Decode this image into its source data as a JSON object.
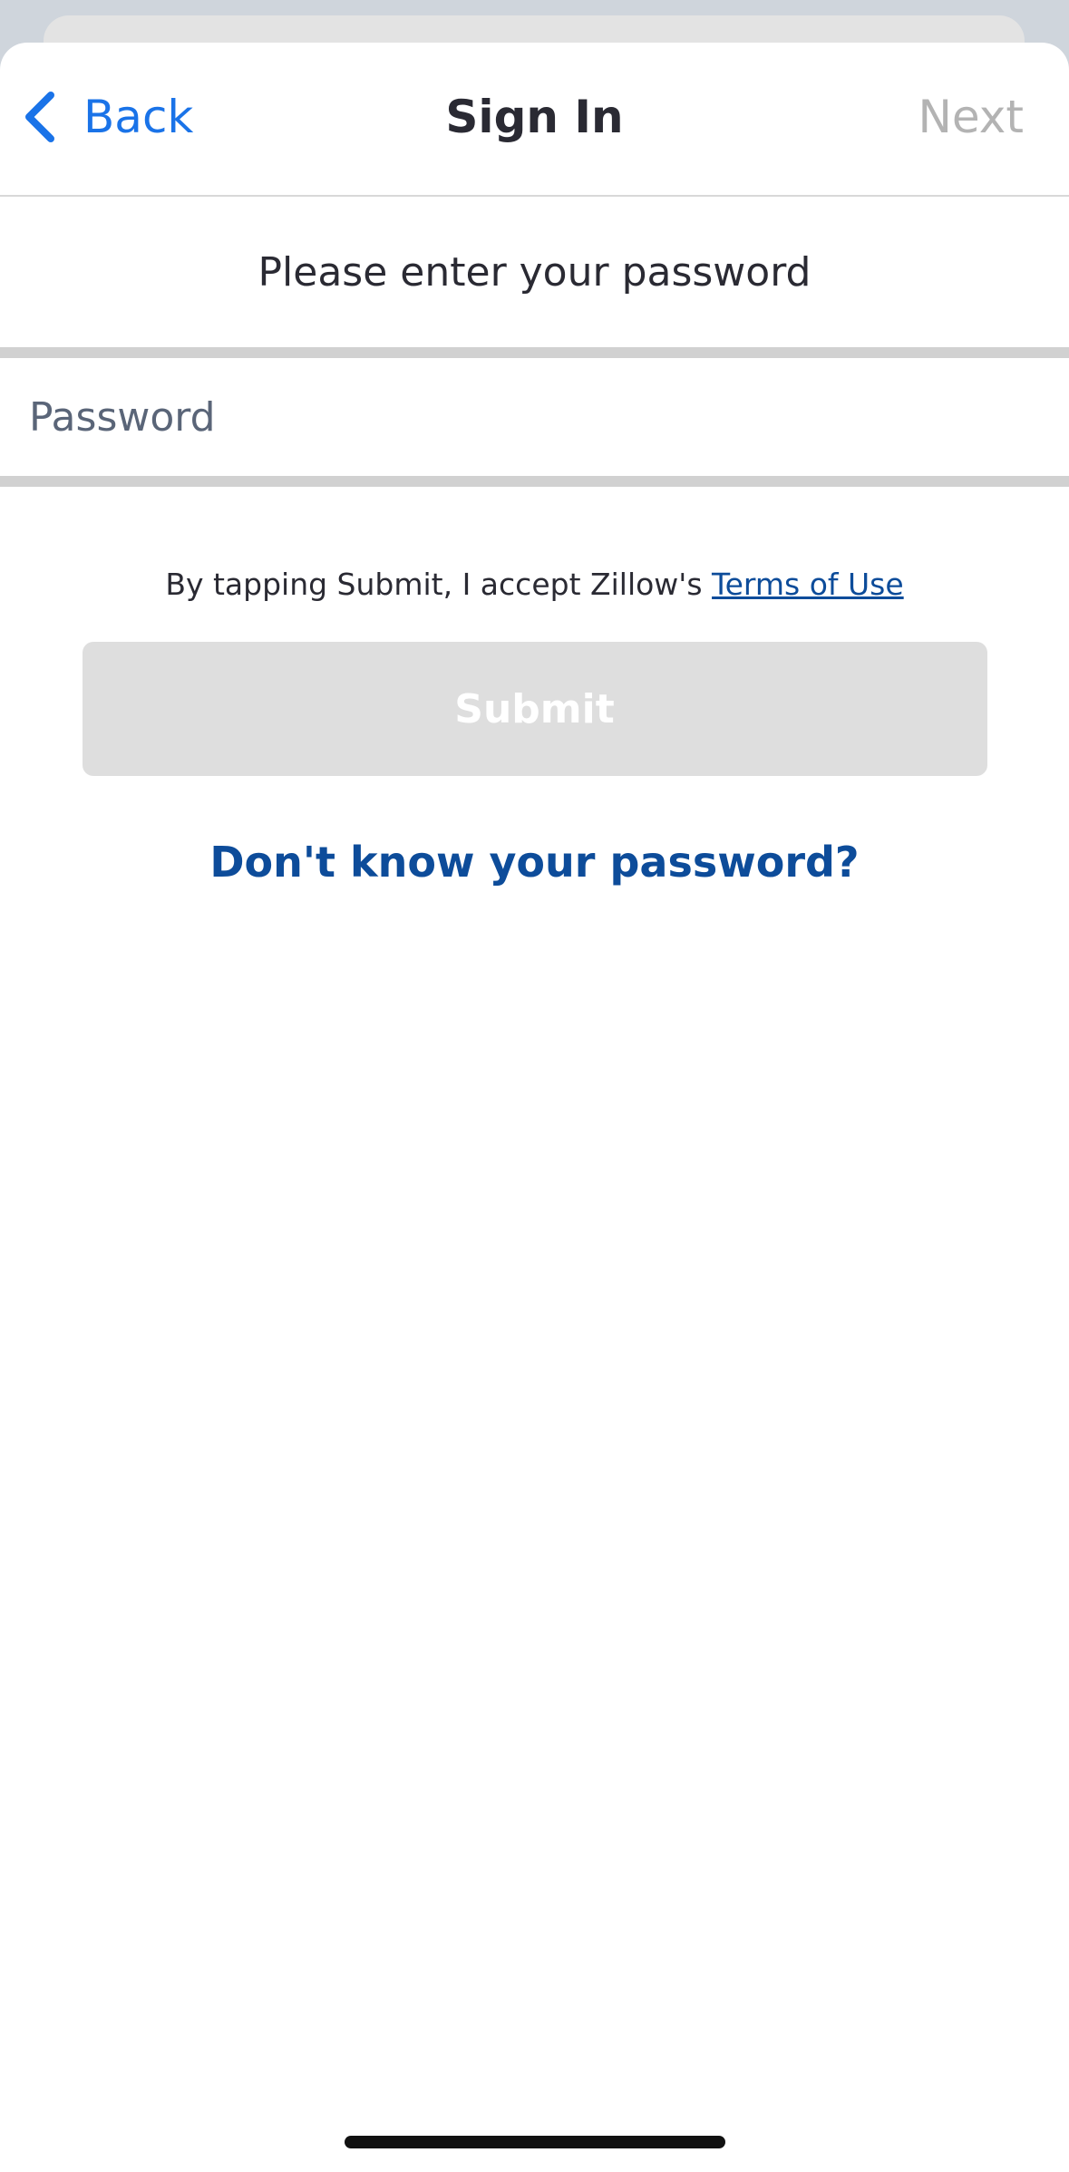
{
  "nav": {
    "back_label": "Back",
    "title": "Sign In",
    "next_label": "Next"
  },
  "prompt": "Please enter your password",
  "password": {
    "placeholder": "Password",
    "value": ""
  },
  "terms": {
    "text": "By tapping Submit, I accept Zillow's",
    "link_label": "Terms of Use"
  },
  "submit_label": "Submit",
  "forgot_label": "Don't know your password?",
  "colors": {
    "link_blue": "#1a73e8",
    "dark_blue": "#0d4c9a",
    "disabled_gray": "#dedede"
  },
  "icons": {
    "back": "chevron-left-icon"
  }
}
